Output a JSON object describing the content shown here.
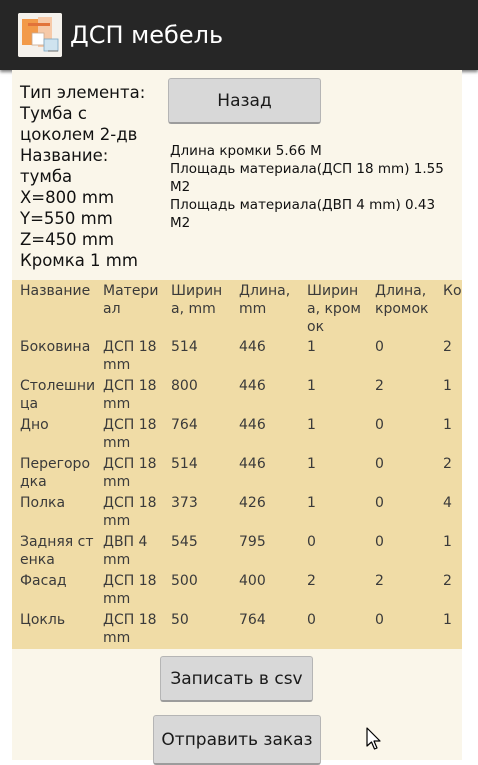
{
  "app": {
    "title": "ДСП мебель"
  },
  "info": {
    "type_line": "Тип элемента:\nТумба с\nцоколем 2-дв",
    "name_line": "Название:\nтумба",
    "x": "X=800 mm",
    "y": "Y=550 mm",
    "z": "Z=450 mm",
    "edge": "Кромка 1 mm"
  },
  "back_button": "Назад",
  "summary": {
    "edge_length": "Длина кромки 5.66 M",
    "area_dsp": "Площадь материала(ДСП 18 mm) 1.55 M2",
    "area_dvp": "Площадь материала(ДВП 4 mm) 0.43 M2"
  },
  "table": {
    "headers": [
      "Название",
      "Материал",
      "Ширина, mm",
      "Длина, mm",
      "Ширина, кромок",
      "Длина, кромок",
      "Кол"
    ],
    "rows": [
      [
        "Боковина",
        "ДСП 18 mm",
        "514",
        "446",
        "1",
        "0",
        "2"
      ],
      [
        "Столешница",
        "ДСП 18 mm",
        "800",
        "446",
        "1",
        "2",
        "1"
      ],
      [
        "Дно",
        "ДСП 18 mm",
        "764",
        "446",
        "1",
        "0",
        "1"
      ],
      [
        "Перегородка",
        "ДСП 18 mm",
        "514",
        "446",
        "1",
        "0",
        "2"
      ],
      [
        "Полка",
        "ДСП 18 mm",
        "373",
        "426",
        "1",
        "0",
        "4"
      ],
      [
        "Задняя стенка",
        "ДВП 4 mm",
        "545",
        "795",
        "0",
        "0",
        "1"
      ],
      [
        "Фасад",
        "ДСП 18 mm",
        "500",
        "400",
        "2",
        "2",
        "2"
      ],
      [
        "Цокль",
        "ДСП 18 mm",
        "50",
        "764",
        "0",
        "0",
        "1"
      ]
    ]
  },
  "buttons": {
    "csv": "Записать в csv",
    "send": "Отправить заказ"
  },
  "colors": {
    "action_bar": "#262626",
    "content_bg": "#faf6ea",
    "table_bg": "#f0dca6",
    "button_bg": "#d8d8d8"
  },
  "icons": {
    "app": "furniture-app-icon",
    "cursor": "mouse-pointer-icon"
  }
}
